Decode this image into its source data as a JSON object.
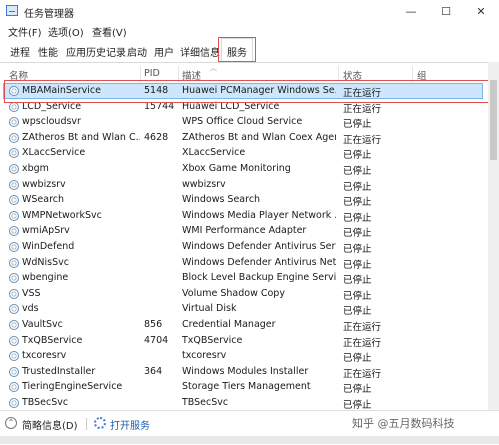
{
  "window": {
    "title": "任务管理器",
    "controls": [
      "—",
      "☐",
      "✕"
    ]
  },
  "menu": [
    "文件(F)",
    "选项(O)",
    "查看(V)"
  ],
  "tabs": [
    "进程",
    "性能",
    "应用历史记录",
    "启动",
    "用户",
    "详细信息",
    "服务"
  ],
  "active_tab": "服务",
  "columns": {
    "name": "名称",
    "pid": "PID",
    "desc": "描述",
    "state": "状态",
    "group": "组"
  },
  "rows": [
    {
      "name": "MBAMainService",
      "pid": "5148",
      "desc": "Huawei PCManager Windows Se...",
      "state": "正在运行",
      "selected": true
    },
    {
      "name": "LCD_Service",
      "pid": "15744",
      "desc": "Huawei LCD_Service",
      "state": "正在运行"
    },
    {
      "name": "wpscloudsvr",
      "pid": "",
      "desc": "WPS Office Cloud Service",
      "state": "已停止"
    },
    {
      "name": "ZAtheros Bt and Wlan C...",
      "pid": "4628",
      "desc": "ZAtheros Bt and Wlan Coex Agent",
      "state": "正在运行"
    },
    {
      "name": "XLaccService",
      "pid": "",
      "desc": "XLaccService",
      "state": "已停止"
    },
    {
      "name": "xbgm",
      "pid": "",
      "desc": "Xbox Game Monitoring",
      "state": "已停止"
    },
    {
      "name": "wwbizsrv",
      "pid": "",
      "desc": "wwbizsrv",
      "state": "已停止"
    },
    {
      "name": "WSearch",
      "pid": "",
      "desc": "Windows Search",
      "state": "已停止"
    },
    {
      "name": "WMPNetworkSvc",
      "pid": "",
      "desc": "Windows Media Player Network ...",
      "state": "已停止"
    },
    {
      "name": "wmiApSrv",
      "pid": "",
      "desc": "WMI Performance Adapter",
      "state": "已停止"
    },
    {
      "name": "WinDefend",
      "pid": "",
      "desc": "Windows Defender Antivirus Serv...",
      "state": "已停止"
    },
    {
      "name": "WdNisSvc",
      "pid": "",
      "desc": "Windows Defender Antivirus Net...",
      "state": "已停止"
    },
    {
      "name": "wbengine",
      "pid": "",
      "desc": "Block Level Backup Engine Service",
      "state": "已停止"
    },
    {
      "name": "VSS",
      "pid": "",
      "desc": "Volume Shadow Copy",
      "state": "已停止"
    },
    {
      "name": "vds",
      "pid": "",
      "desc": "Virtual Disk",
      "state": "已停止"
    },
    {
      "name": "VaultSvc",
      "pid": "856",
      "desc": "Credential Manager",
      "state": "正在运行"
    },
    {
      "name": "TxQBService",
      "pid": "4704",
      "desc": "TxQBService",
      "state": "正在运行"
    },
    {
      "name": "txcoresrv",
      "pid": "",
      "desc": "txcoresrv",
      "state": "已停止"
    },
    {
      "name": "TrustedInstaller",
      "pid": "364",
      "desc": "Windows Modules Installer",
      "state": "正在运行"
    },
    {
      "name": "TieringEngineService",
      "pid": "",
      "desc": "Storage Tiers Management",
      "state": "已停止"
    },
    {
      "name": "TBSecSvc",
      "pid": "",
      "desc": "TBSecSvc",
      "state": "已停止"
    }
  ],
  "footer": {
    "brief": "简略信息(D)",
    "open_services": "打开服务"
  },
  "watermark": "知乎 @五月数码科技",
  "colors": {
    "selected_row": "#cde6fb",
    "highlight_box": "#e05050",
    "link": "#1a5fb4"
  }
}
